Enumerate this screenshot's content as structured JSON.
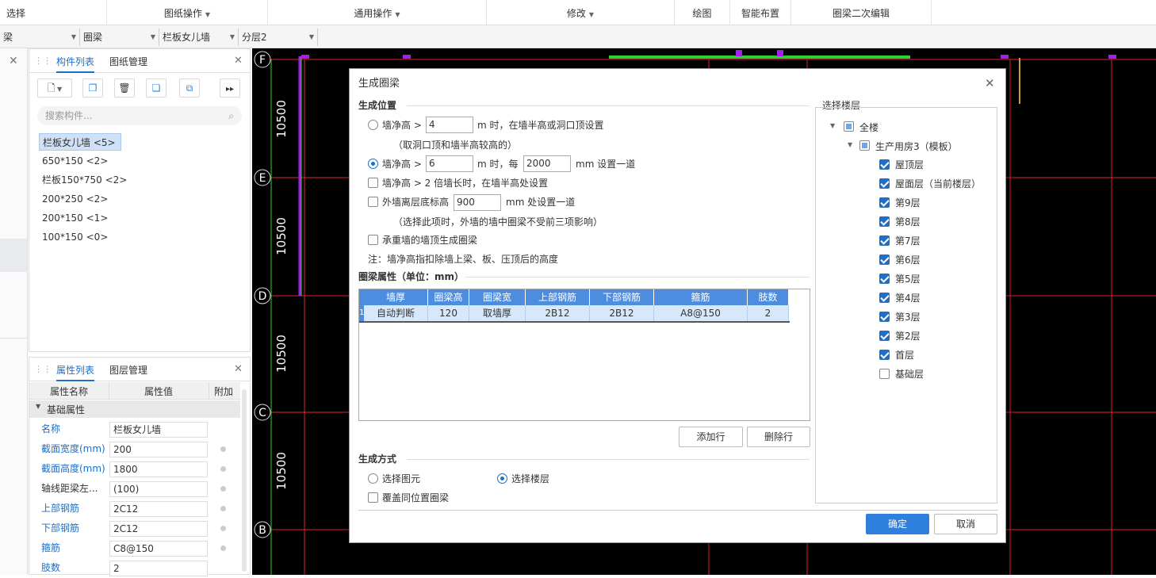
{
  "menubar": {
    "items": [
      {
        "label": "选择",
        "caret": false
      },
      {
        "label": "图纸操作",
        "caret": true
      },
      {
        "label": "通用操作",
        "caret": true
      },
      {
        "label": "修改",
        "caret": true
      },
      {
        "label": "绘图",
        "caret": false
      },
      {
        "label": "智能布置",
        "caret": false
      },
      {
        "label": "圈梁二次编辑",
        "caret": false
      }
    ]
  },
  "toolbar2": {
    "dropdowns": [
      "梁",
      "圈梁",
      "栏板女儿墙",
      "分层2"
    ]
  },
  "component_panel": {
    "tabs": [
      "构件列表",
      "图纸管理"
    ],
    "search_placeholder": "搜索构件...",
    "items": [
      {
        "label": "栏板女儿墙 <5>",
        "selected": true
      },
      {
        "label": "650*150 <2>",
        "selected": false
      },
      {
        "label": "栏板150*750 <2>",
        "selected": false
      },
      {
        "label": "200*250 <2>",
        "selected": false
      },
      {
        "label": "200*150 <1>",
        "selected": false
      },
      {
        "label": "100*150 <0>",
        "selected": false
      }
    ]
  },
  "property_panel": {
    "tabs": [
      "属性列表",
      "图层管理"
    ],
    "headers": [
      "属性名称",
      "属性值",
      "附加"
    ],
    "group": "基础属性",
    "rows": [
      {
        "name": "名称",
        "value": "栏板女儿墙",
        "blue": true,
        "dot": false
      },
      {
        "name": "截面宽度(mm)",
        "value": "200",
        "blue": true,
        "dot": true
      },
      {
        "name": "截面高度(mm)",
        "value": "1800",
        "blue": true,
        "dot": true
      },
      {
        "name": "轴线距梁左...",
        "value": "(100)",
        "blue": false,
        "dot": true
      },
      {
        "name": "上部钢筋",
        "value": "2C12",
        "blue": true,
        "dot": true
      },
      {
        "name": "下部钢筋",
        "value": "2C12",
        "blue": true,
        "dot": true
      },
      {
        "name": "箍筋",
        "value": "C8@150",
        "blue": true,
        "dot": true
      },
      {
        "name": "肢数",
        "value": "2",
        "blue": true,
        "dot": false
      }
    ]
  },
  "cad": {
    "axes": [
      "F",
      "E",
      "D",
      "C",
      "B"
    ],
    "dims": [
      "10500",
      "10500",
      "10500",
      "10500"
    ],
    "colors": {
      "grid": "#e8212b",
      "axis_green": "#2bd22b",
      "purple": "#a020f0"
    }
  },
  "dialog": {
    "title": "生成圈梁",
    "pos_section": "生成位置",
    "opt1_pre": "墙净高 >",
    "opt1_value": "4",
    "opt1_post": "m 时，在墙半高或洞口顶设置",
    "opt1_note": "（取洞口顶和墙半高较高的）",
    "opt2_pre": "墙净高 >",
    "opt2_value": "6",
    "opt2_mid": "m 时，每",
    "opt2_value2": "2000",
    "opt2_post": "mm 设置一道",
    "opt3": "墙净高 > 2 倍墙长时，在墙半高处设置",
    "opt4_pre": "外墙离层底标高",
    "opt4_value": "900",
    "opt4_post": "mm 处设置一道",
    "opt4_note": "（选择此项时，外墙的墙中圈梁不受前三项影响）",
    "opt5": "承重墙的墙顶生成圈梁",
    "note": "注：墙净高指扣除墙上梁、板、压顶后的高度",
    "prop_section": "圈梁属性（单位：mm）",
    "table_headers": [
      "墙厚",
      "圈梁高",
      "圈梁宽",
      "上部钢筋",
      "下部钢筋",
      "箍筋",
      "肢数"
    ],
    "table_row_no": "1",
    "table_row": [
      "自动判断",
      "120",
      "取墙厚",
      "2B12",
      "2B12",
      "A8@150",
      "2"
    ],
    "add_row": "添加行",
    "del_row": "删除行",
    "method_section": "生成方式",
    "method1": "选择图元",
    "method2": "选择楼层",
    "cover": "覆盖同位置圈梁",
    "floor_section": "选择楼层",
    "tree_root": "全楼",
    "tree_building": "生产用房3（模板）",
    "floors": [
      {
        "label": "屋顶层",
        "checked": true
      },
      {
        "label": "屋面层（当前楼层）",
        "checked": true
      },
      {
        "label": "第9层",
        "checked": true
      },
      {
        "label": "第8层",
        "checked": true
      },
      {
        "label": "第7层",
        "checked": true
      },
      {
        "label": "第6层",
        "checked": true
      },
      {
        "label": "第5层",
        "checked": true
      },
      {
        "label": "第4层",
        "checked": true
      },
      {
        "label": "第3层",
        "checked": true
      },
      {
        "label": "第2层",
        "checked": true
      },
      {
        "label": "首层",
        "checked": true
      },
      {
        "label": "基础层",
        "checked": false
      }
    ],
    "ok": "确定",
    "cancel": "取消"
  }
}
